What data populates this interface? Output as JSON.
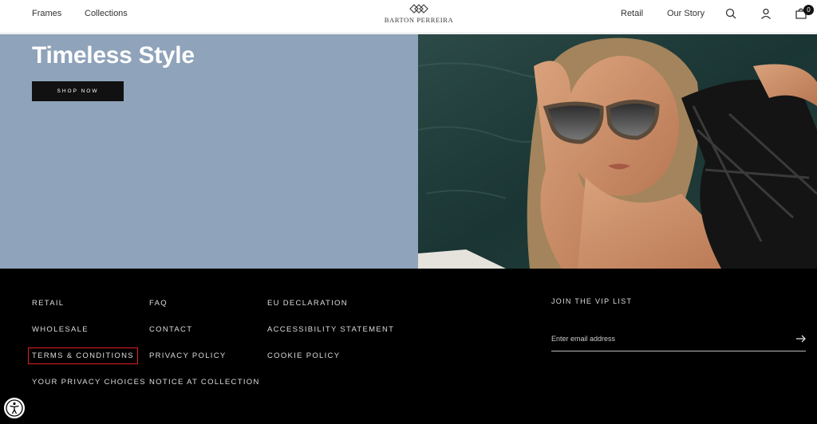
{
  "header": {
    "nav_left": [
      "Frames",
      "Collections"
    ],
    "nav_right": [
      "Retail",
      "Our Story"
    ],
    "logo_text": "BARTON PERREIRA",
    "cart_count": "0",
    "icons": [
      "search-icon",
      "account-icon",
      "cart-icon"
    ]
  },
  "hero": {
    "title": "Timeless Style",
    "button_label": "SHOP NOW",
    "left_panel_color": "#8fa3ba",
    "image_alt": "woman wearing tortoise sunglasses by the pool"
  },
  "footer": {
    "columns": [
      [
        "RETAIL",
        "WHOLESALE",
        "TERMS & CONDITIONS",
        "YOUR PRIVACY CHOICES"
      ],
      [
        "FAQ",
        "CONTACT",
        "PRIVACY POLICY",
        "NOTICE AT COLLECTION"
      ],
      [
        "EU DECLARATION",
        "ACCESSIBILITY STATEMENT",
        "COOKIE POLICY"
      ]
    ],
    "vip_label": "JOIN THE VIP LIST",
    "email_placeholder": "Enter email address",
    "highlight_color": "#d22222"
  }
}
